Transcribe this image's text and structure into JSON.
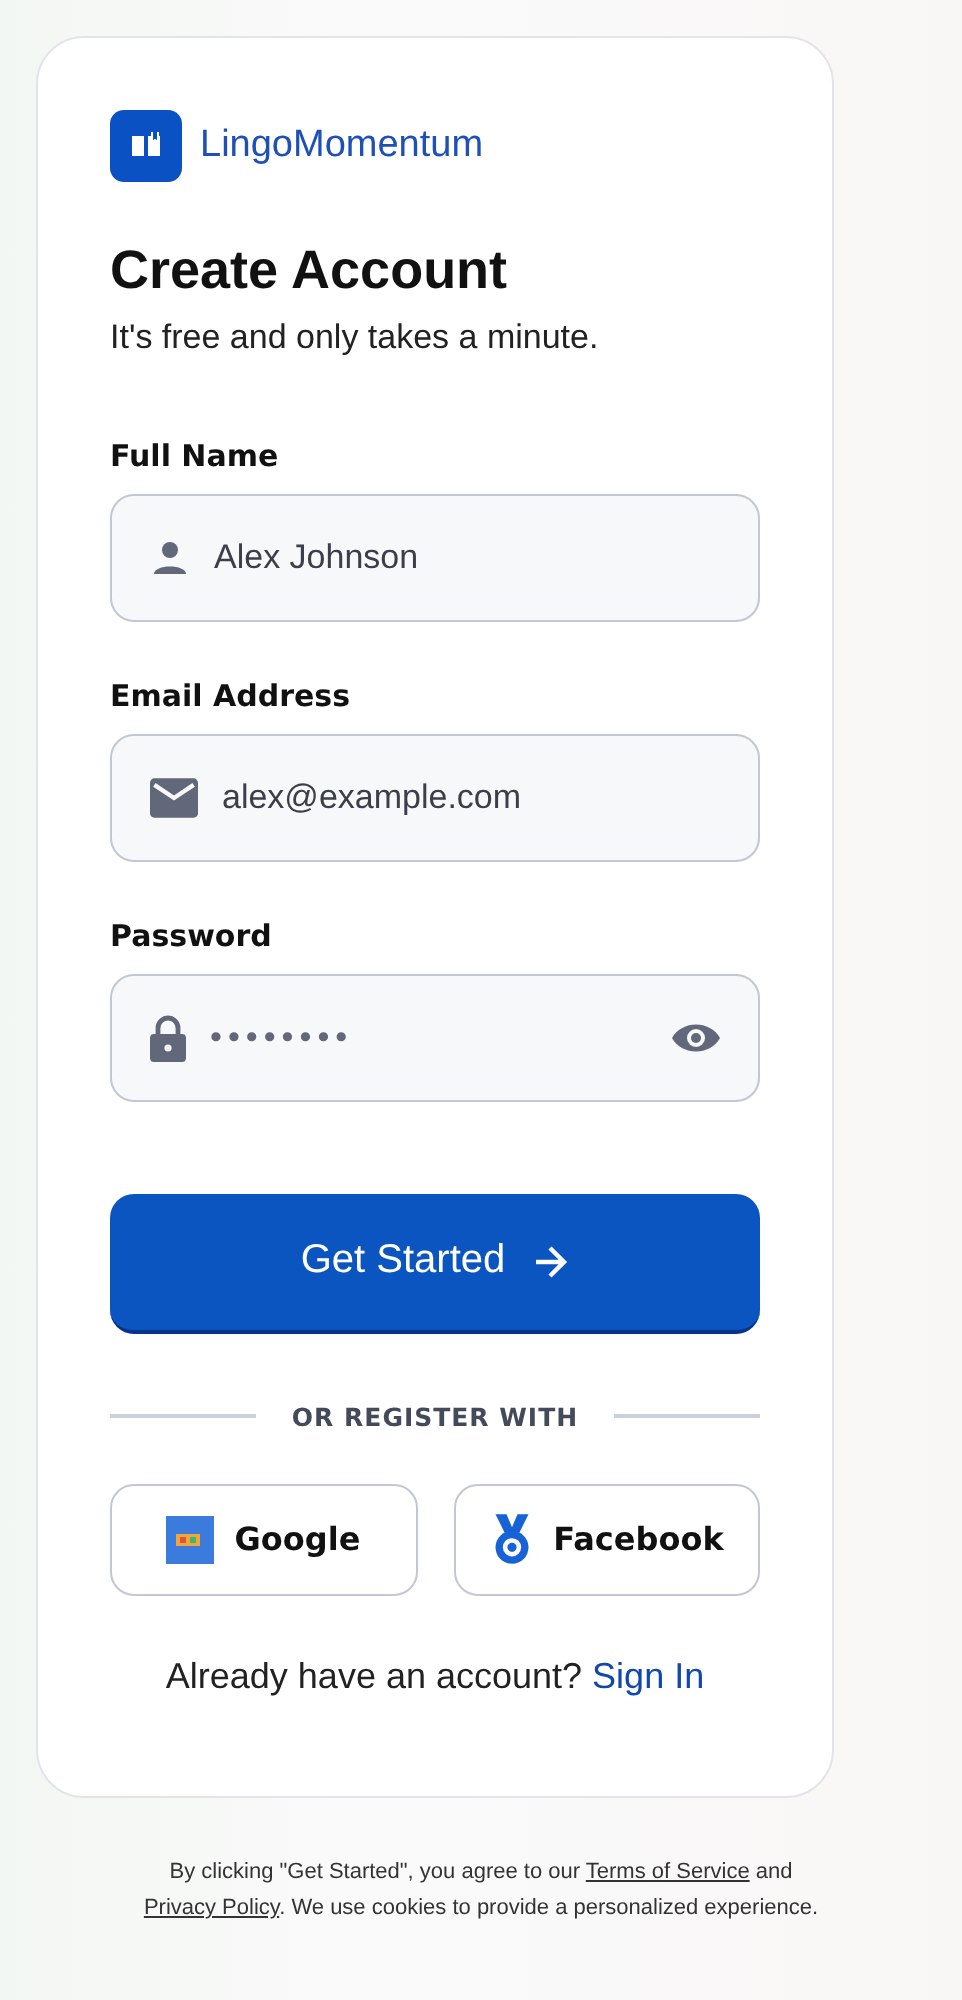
{
  "brand": {
    "name": "LingoMomentum"
  },
  "heading": "Create Account",
  "subheading": "It's free and only takes a minute.",
  "fields": [
    {
      "label": "Full Name",
      "kind": "person",
      "value": "Alex Johnson"
    },
    {
      "label": "Email Address",
      "kind": "mail",
      "value": "alex@example.com"
    },
    {
      "label": "Password",
      "kind": "lock",
      "value": "••••••••"
    }
  ],
  "submit": {
    "label": "Get Started"
  },
  "divider": "OR REGISTER WITH",
  "social": [
    {
      "kind": "google",
      "label": "Google"
    },
    {
      "kind": "facebook",
      "label": "Facebook"
    }
  ],
  "signin": {
    "text": "Already have an account?",
    "link": "Sign In"
  },
  "footer": [
    {
      "kind": "text",
      "text": "By clicking \"Get Started\", you agree to our "
    },
    {
      "kind": "link",
      "text": "Terms of Service"
    },
    {
      "kind": "text",
      "text": " and "
    },
    {
      "kind": "link",
      "text": "Privacy Policy"
    },
    {
      "kind": "text",
      "text": ". We use cookies to provide a personalized experience."
    }
  ]
}
